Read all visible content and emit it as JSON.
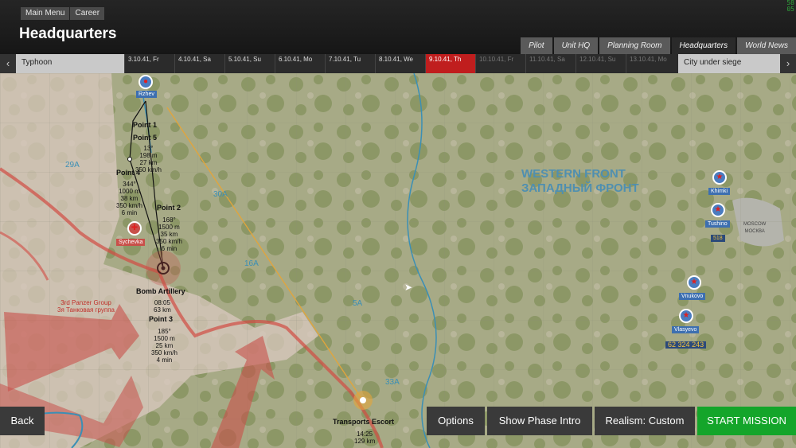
{
  "header": {
    "breadcrumbs": [
      "Main Menu",
      "Career"
    ],
    "title": "Headquarters",
    "clock": [
      "58",
      "05"
    ]
  },
  "tabs": [
    "Pilot",
    "Unit HQ",
    "Planning Room",
    "Headquarters",
    "World News"
  ],
  "active_tab": "Headquarters",
  "timeline": {
    "left_label": "Typhoon",
    "right_label": "City under siege",
    "days": [
      {
        "day": "3",
        "date": ".10.41, Fr"
      },
      {
        "day": "4",
        "date": ".10.41, Sa"
      },
      {
        "day": "5",
        "date": ".10.41, Su"
      },
      {
        "day": "6",
        "date": ".10.41, Mo"
      },
      {
        "day": "7",
        "date": ".10.41, Tu"
      },
      {
        "day": "8",
        "date": ".10.41, We"
      },
      {
        "day": "9",
        "date": ".10.41, Th"
      },
      {
        "day": "10",
        "date": ".10.41, Fr"
      },
      {
        "day": "11",
        "date": ".10.41, Sa"
      },
      {
        "day": "12",
        "date": ".10.41, Su"
      },
      {
        "day": "13",
        "date": ".10.41, Mo"
      }
    ]
  },
  "map": {
    "front_en": "WESTERN FRONT",
    "front_ru": "ЗАПАДНЫЙ ФРОНТ",
    "panzer_en": "3rd Panzer Group",
    "panzer_ru": "3я Танковая группа",
    "city": "Sychevka",
    "airfield_top": "Rzhev",
    "airfields_right": [
      "Khimki",
      "Tushino",
      "Vnukovo",
      "Vlasyevo"
    ],
    "moscow_en": "MOSCOW",
    "moscow_ru": "МОСКВА",
    "army_labels": [
      "29A",
      "30A",
      "16A",
      "5A",
      "33A"
    ],
    "waypoints": [
      {
        "name": "Point 1",
        "info": []
      },
      {
        "name": "Point 5",
        "info": [
          "13°",
          "198 m",
          "27 km",
          "350 km/h"
        ]
      },
      {
        "name": "Point 4",
        "info": [
          "344°",
          "1000 m",
          "38 km",
          "350 km/h",
          "6 min"
        ]
      },
      {
        "name": "Point 2",
        "info": [
          "168°",
          "1500 m",
          "35 km",
          "350 km/h",
          "6 min"
        ]
      },
      {
        "name": "Bomb Artillery",
        "info": [
          "08:05",
          "63 km"
        ]
      },
      {
        "name": "Point 3",
        "info": [
          "185°",
          "1500 m",
          "25 km",
          "350 km/h",
          "4 min"
        ]
      }
    ],
    "escort": {
      "name": "Transports Escort",
      "time": "14:25",
      "dist": "129 km"
    },
    "counts": [
      "518",
      "62",
      "324",
      "243"
    ]
  },
  "buttons": {
    "back": "Back",
    "options": "Options",
    "phase": "Show Phase Intro",
    "realism": "Realism: Custom",
    "start": "START MISSION"
  },
  "colors": {
    "accent_red": "#c01e1e",
    "start_green": "#14a52a",
    "map_green": "#8f9a6a"
  }
}
